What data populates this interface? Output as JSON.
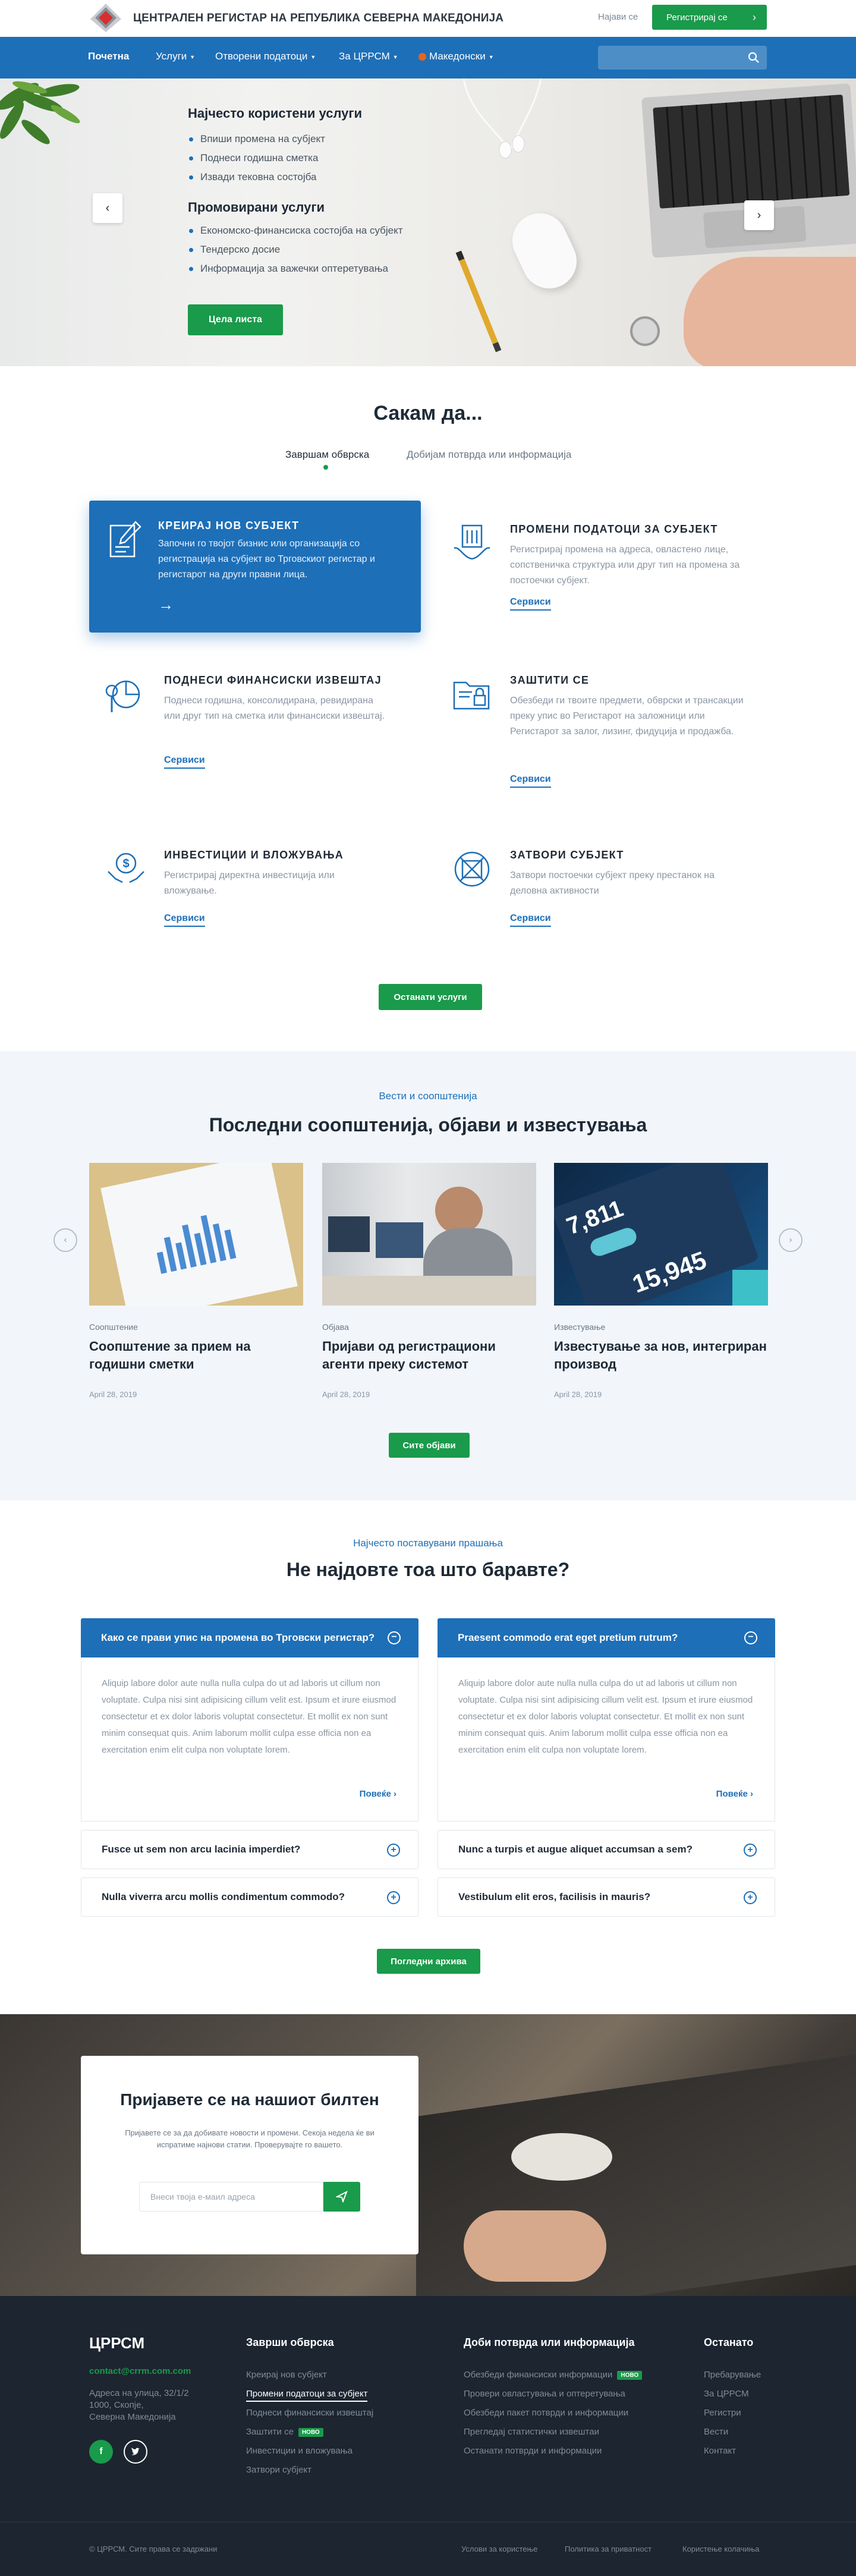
{
  "header": {
    "site_title": "ЦЕНТРАЛЕН РЕГИСТАР НА РЕПУБЛИКА СЕВЕРНА МАКЕДОНИЈА",
    "login": "Најави се",
    "register": "Регистрирај се",
    "accent_color": "#1a9a4b",
    "brand_color": "#1d6fb8"
  },
  "nav": {
    "items": [
      "Почетна",
      "Услуги",
      "Отворени податоци",
      "За ЦРРСМ",
      "Македонски"
    ],
    "search_placeholder": ""
  },
  "hero": {
    "group1_title": "Најчесто користени услуги",
    "group1_items": [
      "Впиши промена на субјект",
      "Поднеси годишна сметка",
      "Извади тековна состојба"
    ],
    "group2_title": "Промовирани услуги",
    "group2_items": [
      "Економско-финансиска состојба на субјект",
      "Тендерско досие",
      "Информација за важечки оптеретувања"
    ],
    "button": "Цела листа"
  },
  "sakam": {
    "title": "Сакам да...",
    "tab_active": "Завршам обврска",
    "tab_inactive": "Добијам потврда или информација",
    "services": [
      {
        "title": "КРЕИРАЈ НОВ СУБЈЕКТ",
        "text": "Започни го твојот бизнис или организација со регистрација на субјект во Трговскиот регистар и регистарот на други правни лица.",
        "link": ""
      },
      {
        "title": "ПРОМЕНИ ПОДАТОЦИ ЗА СУБЈЕКТ",
        "text": "Регистрирај промена на адреса, овластено лице, сопственичка структура или друг тип на промена за постоечки субјект.",
        "link": "Сервиси"
      },
      {
        "title": "ПОДНЕСИ ФИНАНСИСКИ ИЗВЕШТАЈ",
        "text": "Поднеси годишна, консолидирана, ревидирана или друг тип на сметка или финансиски извештај.",
        "link": "Сервиси"
      },
      {
        "title": "ЗАШТИТИ СЕ",
        "text": "Обезбеди ги твоите предмети, обврски и трансакции преку упис во Регистарот на заложници или Регистарот за залог, лизинг, фидуција и продажба.",
        "link": "Сервиси"
      },
      {
        "title": "ИНВЕСТИЦИИ И ВЛОЖУВАЊА",
        "text": "Регистрирај директна инвестиција или вложување.",
        "link": "Сервиси"
      },
      {
        "title": "ЗАТВОРИ СУБЈЕКТ",
        "text": "Затвори постоечки субјект преку престанок на деловна активности",
        "link": "Сервиси"
      }
    ],
    "other_button": "Останати услуги"
  },
  "news": {
    "kicker": "Вести и соопштенија",
    "title": "Последни соопштенија, објави и известувања",
    "items": [
      {
        "category": "Соопштение",
        "title": "Соопштение за  прием на годишни сметки",
        "date": "April 28, 2019"
      },
      {
        "category": "Објава",
        "title": "Пријави од регистрациони агенти преку системот",
        "date": "April 28, 2019"
      },
      {
        "category": "Известување",
        "title": "Известување за нов, интегриран производ",
        "date": "April 28, 2019"
      }
    ],
    "all_button": "Сите објави"
  },
  "faq": {
    "kicker": "Најчесто поставувани прашања",
    "title": "Не најдовте тоа што баравте?",
    "open": [
      {
        "q": "Како се прави упис на промена во Трговски регистар?",
        "a": "Aliquip labore dolor aute nulla nulla culpa do ut ad laboris ut cillum non voluptate. Culpa nisi sint adipisicing cillum velit est. Ipsum et irure eiusmod consectetur et ex dolor laboris voluptat consectetur. Et mollit ex non sunt minim consequat quis.  Anim laborum mollit culpa esse officia non ea exercitation enim elit  culpa non voluptate lorem.",
        "more": "Повеќе"
      },
      {
        "q": "Praesent commodo erat eget pretium rutrum?",
        "a": "Aliquip labore dolor aute nulla nulla culpa do ut ad laboris ut cillum non voluptate. Culpa nisi sint adipisicing cillum velit est. Ipsum et irure eiusmod consectetur et ex dolor laboris voluptat consectetur. Et mollit ex non sunt minim consequat quis.  Anim laborum mollit culpa esse officia non ea exercitation enim elit  culpa non voluptate lorem.",
        "more": "Повеќе"
      }
    ],
    "closed_left": [
      "Fusce ut sem non arcu lacinia imperdiet?",
      "Nulla viverra arcu mollis condimentum commodo?"
    ],
    "closed_right": [
      "Nunc a turpis et augue aliquet accumsan a sem?",
      "Vestibulum elit eros, facilisis in mauris?"
    ],
    "archive_button": "Погледни архива"
  },
  "newsletter": {
    "title": "Пријавете се на нашиот билтен",
    "text": "Пријавете се за да добивате новости и промени. Секоја недела ќе ви испратиме најнови статии. Проверувајте го вашето.",
    "placeholder": "Внеси твоја е-маил адреса"
  },
  "footer": {
    "brand": "ЦРРСМ",
    "email": "contact@crrm.com.com",
    "address": [
      "Адреса на улица, 32/1/2",
      "1000, Скопје,",
      "Северна Македонија"
    ],
    "col1_title": "Заврши обврска",
    "col1_items": [
      "Креирај нов субјект",
      "Промени податоци за субјект",
      "Поднеси финансиски извештај",
      "Заштити се",
      "Инвестиции и вложувања",
      "Затвори субјект"
    ],
    "col2_title": "Доби потврда или информација",
    "col2_items": [
      "Обезбеди финансиски информации",
      "Провери овластувања и оптеретувања",
      "Обезбеди пакет потврди и информации",
      "Прегледај статистички извештаи",
      "Останати потврди и информации"
    ],
    "col3_title": "Останато",
    "col3_items": [
      "Пребарување",
      "За ЦРРСМ",
      "Регистри",
      "Вести",
      "Контакт"
    ],
    "badge": "НОВО",
    "copyright": "© ЦРРСМ. Сите права се задржани",
    "bottom_links": [
      "Услови за користење",
      "Политика за приватност",
      "Користење колачиња"
    ]
  }
}
